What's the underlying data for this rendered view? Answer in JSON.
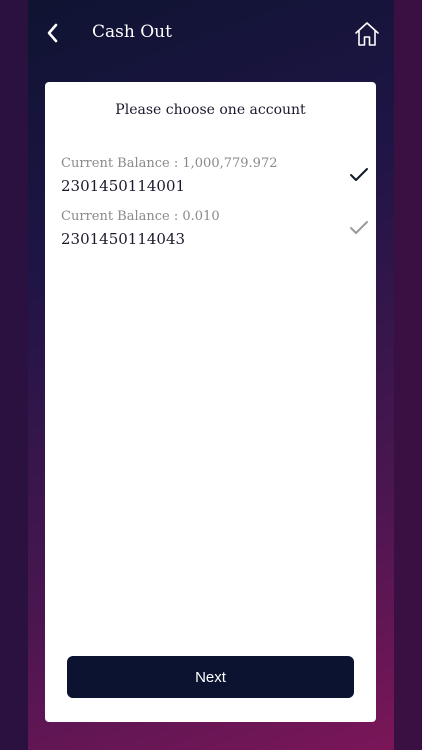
{
  "header": {
    "title": "Cash Out"
  },
  "card": {
    "heading": "Please choose one account"
  },
  "accounts": [
    {
      "balance_text": "Current Balance : 1,000,779.972",
      "number": "2301450114001",
      "selected": true
    },
    {
      "balance_text": "Current Balance : 0.010",
      "number": "2301450114043",
      "selected": false
    }
  ],
  "actions": {
    "next_label": "Next"
  },
  "colors": {
    "primary_dark": "#0c1330",
    "check_selected": "#111827",
    "check_unselected": "#9a9a9a",
    "muted_text": "#8a8a8a"
  },
  "icons": {
    "back": "chevron-left-icon",
    "home": "home-icon",
    "check": "checkmark-icon"
  }
}
